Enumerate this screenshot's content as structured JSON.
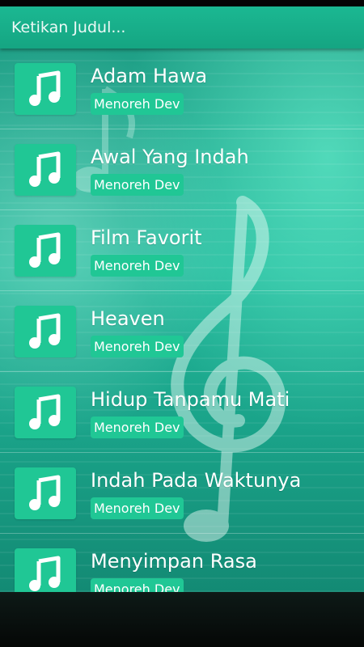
{
  "search": {
    "placeholder": "Ketikan Judul..."
  },
  "colors": {
    "accent": "#20c795",
    "header": "#1bb892"
  },
  "icons": {
    "song": "music-note-icon"
  },
  "songs": [
    {
      "title": "Adam Hawa",
      "artist": "Menoreh Dev"
    },
    {
      "title": "Awal Yang Indah",
      "artist": "Menoreh Dev"
    },
    {
      "title": "Film Favorit",
      "artist": "Menoreh Dev"
    },
    {
      "title": "Heaven",
      "artist": "Menoreh Dev"
    },
    {
      "title": "Hidup Tanpamu Mati",
      "artist": "Menoreh Dev"
    },
    {
      "title": "Indah Pada Waktunya",
      "artist": "Menoreh Dev"
    },
    {
      "title": "Menyimpan Rasa",
      "artist": "Menoreh Dev"
    }
  ]
}
